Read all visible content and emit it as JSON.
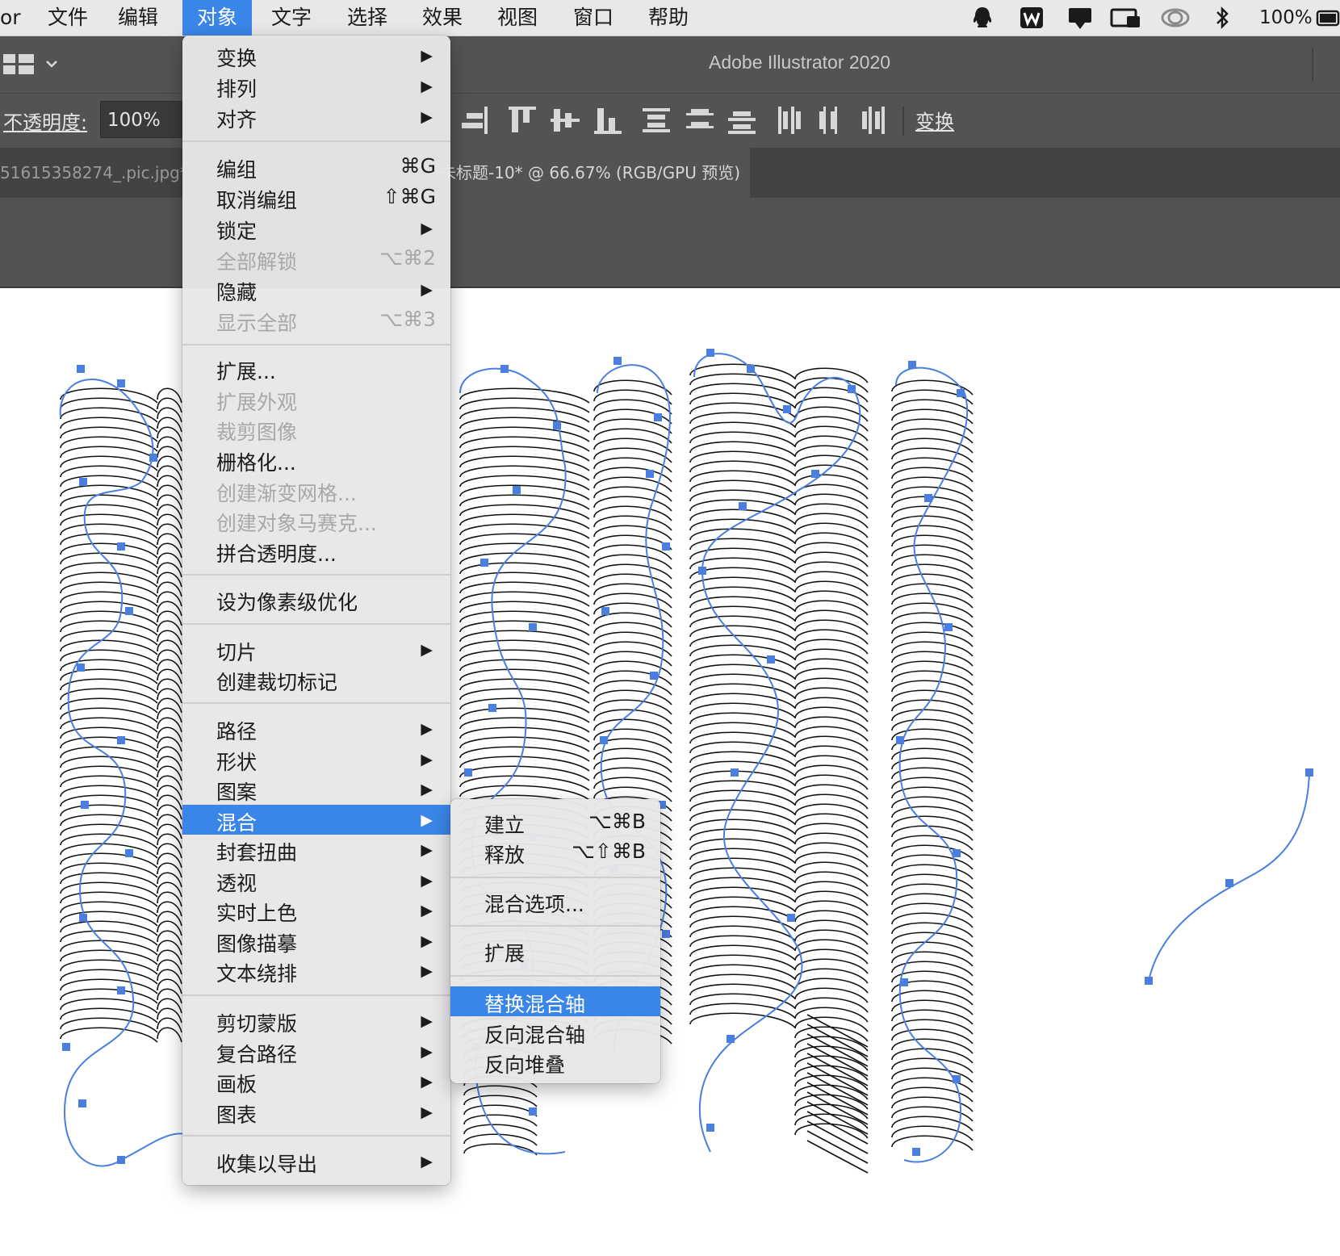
{
  "menubar": {
    "app_fragment": "or",
    "items": [
      "文件",
      "编辑",
      "对象",
      "文字",
      "选择",
      "效果",
      "视图",
      "窗口",
      "帮助"
    ],
    "active_item": "对象",
    "battery": "100%"
  },
  "app": {
    "title": "Adobe Illustrator 2020",
    "opacity_label": "不透明度:",
    "opacity_value": "100%",
    "transform_label": "变换"
  },
  "document_tabs": [
    {
      "label": "51615358274_.pic.jpg*"
    },
    {
      "label": "未标题-10* @ 66.67% (RGB/GPU 预览)"
    }
  ],
  "object_menu": {
    "items": [
      {
        "label": "变换",
        "submenu": true
      },
      {
        "label": "排列",
        "submenu": true
      },
      {
        "label": "对齐",
        "submenu": true
      },
      {
        "label": "编组",
        "shortcut": "⌘G"
      },
      {
        "label": "取消编组",
        "shortcut": "⇧⌘G"
      },
      {
        "label": "锁定",
        "submenu": true
      },
      {
        "label": "全部解锁",
        "shortcut": "⌥⌘2",
        "disabled": true
      },
      {
        "label": "隐藏",
        "submenu": true
      },
      {
        "label": "显示全部",
        "shortcut": "⌥⌘3",
        "disabled": true
      },
      {
        "label": "扩展..."
      },
      {
        "label": "扩展外观",
        "disabled": true
      },
      {
        "label": "裁剪图像",
        "disabled": true
      },
      {
        "label": "栅格化..."
      },
      {
        "label": "创建渐变网格...",
        "disabled": true
      },
      {
        "label": "创建对象马赛克...",
        "disabled": true
      },
      {
        "label": "拼合透明度..."
      },
      {
        "label": "设为像素级优化"
      },
      {
        "label": "切片",
        "submenu": true
      },
      {
        "label": "创建裁切标记"
      },
      {
        "label": "路径",
        "submenu": true
      },
      {
        "label": "形状",
        "submenu": true
      },
      {
        "label": "图案",
        "submenu": true
      },
      {
        "label": "混合",
        "submenu": true,
        "highlighted": true
      },
      {
        "label": "封套扭曲",
        "submenu": true
      },
      {
        "label": "透视",
        "submenu": true
      },
      {
        "label": "实时上色",
        "submenu": true
      },
      {
        "label": "图像描摹",
        "submenu": true
      },
      {
        "label": "文本绕排",
        "submenu": true
      },
      {
        "label": "剪切蒙版",
        "submenu": true
      },
      {
        "label": "复合路径",
        "submenu": true
      },
      {
        "label": "画板",
        "submenu": true
      },
      {
        "label": "图表",
        "submenu": true
      },
      {
        "label": "收集以导出",
        "submenu": true
      }
    ]
  },
  "blend_submenu": {
    "items": [
      {
        "label": "建立",
        "shortcut": "⌥⌘B"
      },
      {
        "label": "释放",
        "shortcut": "⌥⇧⌘B"
      },
      {
        "label": "混合选项..."
      },
      {
        "label": "扩展"
      },
      {
        "label": "替换混合轴",
        "highlighted": true
      },
      {
        "label": "反向混合轴"
      },
      {
        "label": "反向堆叠"
      }
    ]
  },
  "colors": {
    "menu_highlight": "#3a86e8",
    "chrome_dark": "#535353",
    "selection_blue": "#4a7fe0"
  }
}
